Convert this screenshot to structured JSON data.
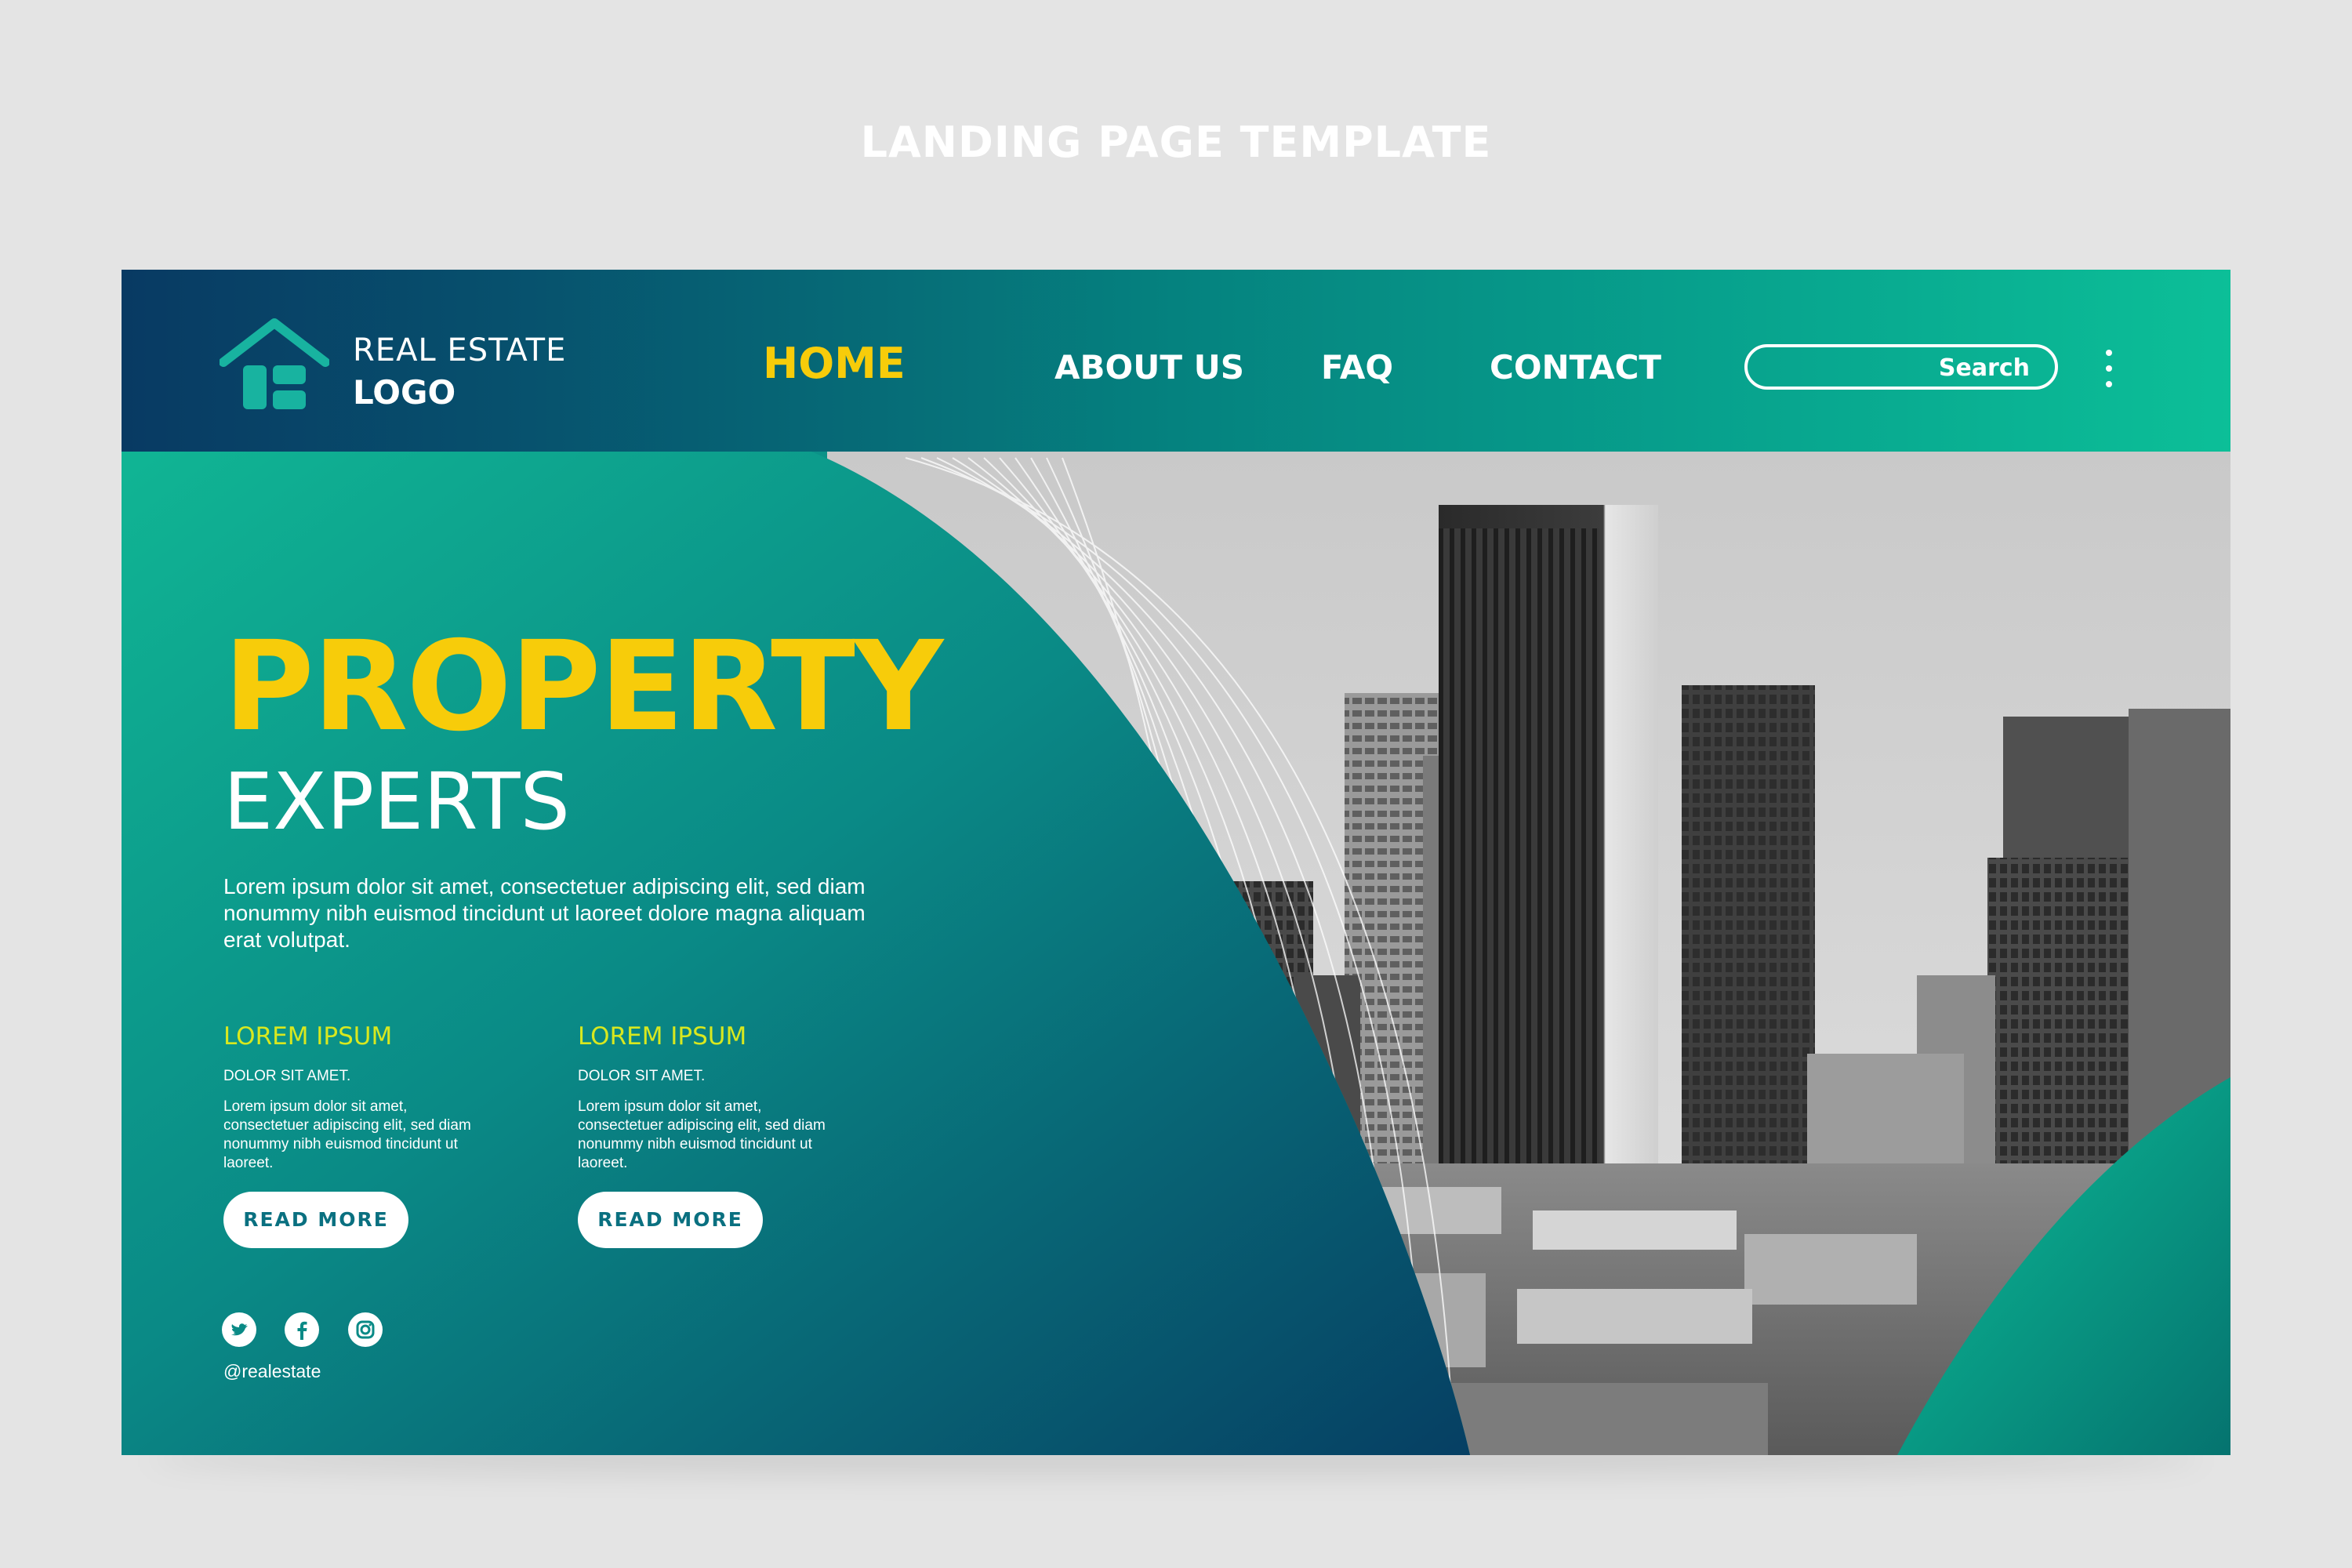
{
  "caption": "LANDING PAGE TEMPLATE",
  "header": {
    "logo_line1": "REAL ESTATE",
    "logo_line2": "LOGO",
    "nav": {
      "home": "HOME",
      "about": "ABOUT US",
      "faq": "FAQ",
      "contact": "CONTACT"
    },
    "search_label": "Search"
  },
  "hero": {
    "title_line1": "PROPERTY",
    "title_line2": "EXPERTS",
    "intro": "Lorem ipsum dolor sit amet, consectetuer adipiscing elit, sed diam nonummy nibh euismod tincidunt ut laoreet dolore magna aliquam erat volutpat."
  },
  "features": [
    {
      "title": "LOREM IPSUM",
      "subtitle": "DOLOR SIT AMET.",
      "text": "Lorem ipsum dolor sit amet, consectetuer adipiscing elit, sed diam nonummy nibh euismod tincidunt ut laoreet.",
      "button": "READ MORE"
    },
    {
      "title": "LOREM IPSUM",
      "subtitle": "DOLOR SIT AMET.",
      "text": "Lorem ipsum dolor sit amet, consectetuer adipiscing elit, sed diam nonummy nibh euismod tincidunt ut laoreet.",
      "button": "READ MORE"
    }
  ],
  "social": {
    "icons": [
      "twitter-icon",
      "facebook-icon",
      "instagram-icon"
    ],
    "handle": "@realestate"
  },
  "colors": {
    "accent_yellow": "#f7cc0a",
    "accent_lime": "#d8e81f",
    "teal": "#0a8a86",
    "navy": "#063f63",
    "background": "#e4e4e4"
  }
}
